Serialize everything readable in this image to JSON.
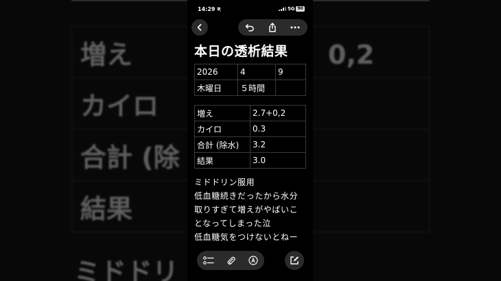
{
  "status_bar": {
    "time": "14:29",
    "network": "5G",
    "battery": "90"
  },
  "note": {
    "title": "本日の透析結果",
    "date_table": [
      [
        "2026",
        "4",
        "9"
      ],
      [
        "木曜日",
        "５時間",
        ""
      ]
    ],
    "results_table": [
      [
        "増え",
        "2.7+0,2"
      ],
      [
        "カイロ",
        "0.3"
      ],
      [
        "合計 (除水)",
        "3.2"
      ],
      [
        "結果",
        "3.0"
      ]
    ],
    "body_lines": [
      "ミドドリン服用",
      "低血糖続きだったから水分",
      "取りすぎて増えがやばいこ",
      "となってしまった泣",
      "低血糖気をつけないとねー"
    ]
  },
  "background": {
    "rows": [
      "増え",
      "カイロ",
      "合計 (除",
      "結果"
    ],
    "value_fragment": "0,2",
    "note_fragment": "ミドドリ"
  },
  "icons": {
    "toolbar": [
      "back-icon",
      "undo-icon",
      "share-icon",
      "more-icon"
    ],
    "bottom": [
      "checklist-icon",
      "paperclip-icon",
      "pen-icon",
      "compose-icon"
    ]
  },
  "colors": {
    "background": "#000000",
    "button_fill": "#2b2b2b",
    "table_border": "#3a3a3a",
    "text": "#ffffff"
  }
}
